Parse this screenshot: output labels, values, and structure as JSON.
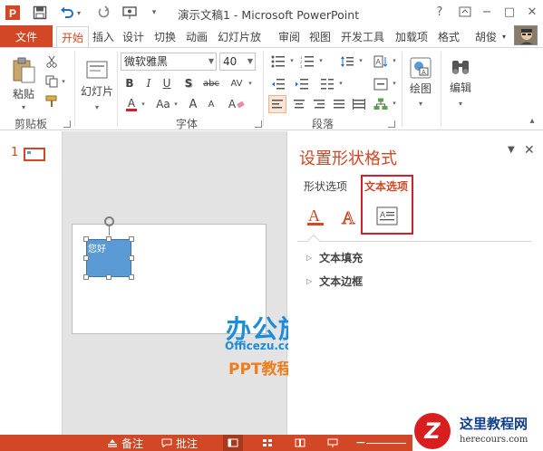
{
  "colors": {
    "accent": "#d24726",
    "shape_fill": "#5b9bd5",
    "highlight_box": "#d0202a",
    "watermark_blue": "#1c8ddb",
    "watermark_orange": "#f07d1c",
    "corner_red": "#d81e1e",
    "corner_navy": "#123f8b"
  },
  "window": {
    "title": "演示文稿1 - Microsoft PowerPoint",
    "help": "?",
    "minimize": "−",
    "maximize": "□",
    "close": "✕"
  },
  "quick_access": {
    "app_icon_letter": "P",
    "save_icon": "floppy-disk",
    "undo_icon": "undo-arrow",
    "redo_icon": "redo",
    "start_icon": "start-from-beginning"
  },
  "tabs": {
    "file": "文件",
    "items": [
      "开始",
      "插入",
      "设计",
      "切换",
      "动画",
      "幻灯片放",
      "审阅",
      "视图",
      "开发工具",
      "加载项",
      "格式"
    ],
    "user": "胡俊"
  },
  "ribbon": {
    "clipboard": {
      "paste_label": "粘贴",
      "group_label": "剪贴板"
    },
    "slides": {
      "slides_label": "幻灯片",
      "group_label": ""
    },
    "font": {
      "font_name": "微软雅黑",
      "font_size": "40",
      "bold": "B",
      "italic": "I",
      "underline": "U",
      "shadow": "S",
      "strike": "abc",
      "spacing": "AV",
      "case": "Aa",
      "color": "A",
      "grow": "A",
      "shrink": "A",
      "clear": "A",
      "group_label": "字体"
    },
    "paragraph": {
      "group_label": "段落"
    },
    "drawing": {
      "label": "绘图"
    },
    "editing": {
      "label": "编辑"
    }
  },
  "thumbnails": {
    "slide_number": "1"
  },
  "slide": {
    "shape_text": "您好"
  },
  "watermark": {
    "main": "办公族",
    "sub": "Officezu.com",
    "ppt": "PPT教程"
  },
  "task_pane": {
    "title": "设置形状格式",
    "tab_shape_options": "形状选项",
    "tab_text_options": "文本选项",
    "icons": [
      "text-fill-outline-icon",
      "text-effects-icon",
      "textbox-icon"
    ],
    "sections": [
      "文本填充",
      "文本边框"
    ]
  },
  "statusbar": {
    "notes": "备注",
    "comments": "批注"
  },
  "corner_logo": {
    "letter": "Z",
    "title": "这里教程网",
    "url": "herecours.com"
  }
}
